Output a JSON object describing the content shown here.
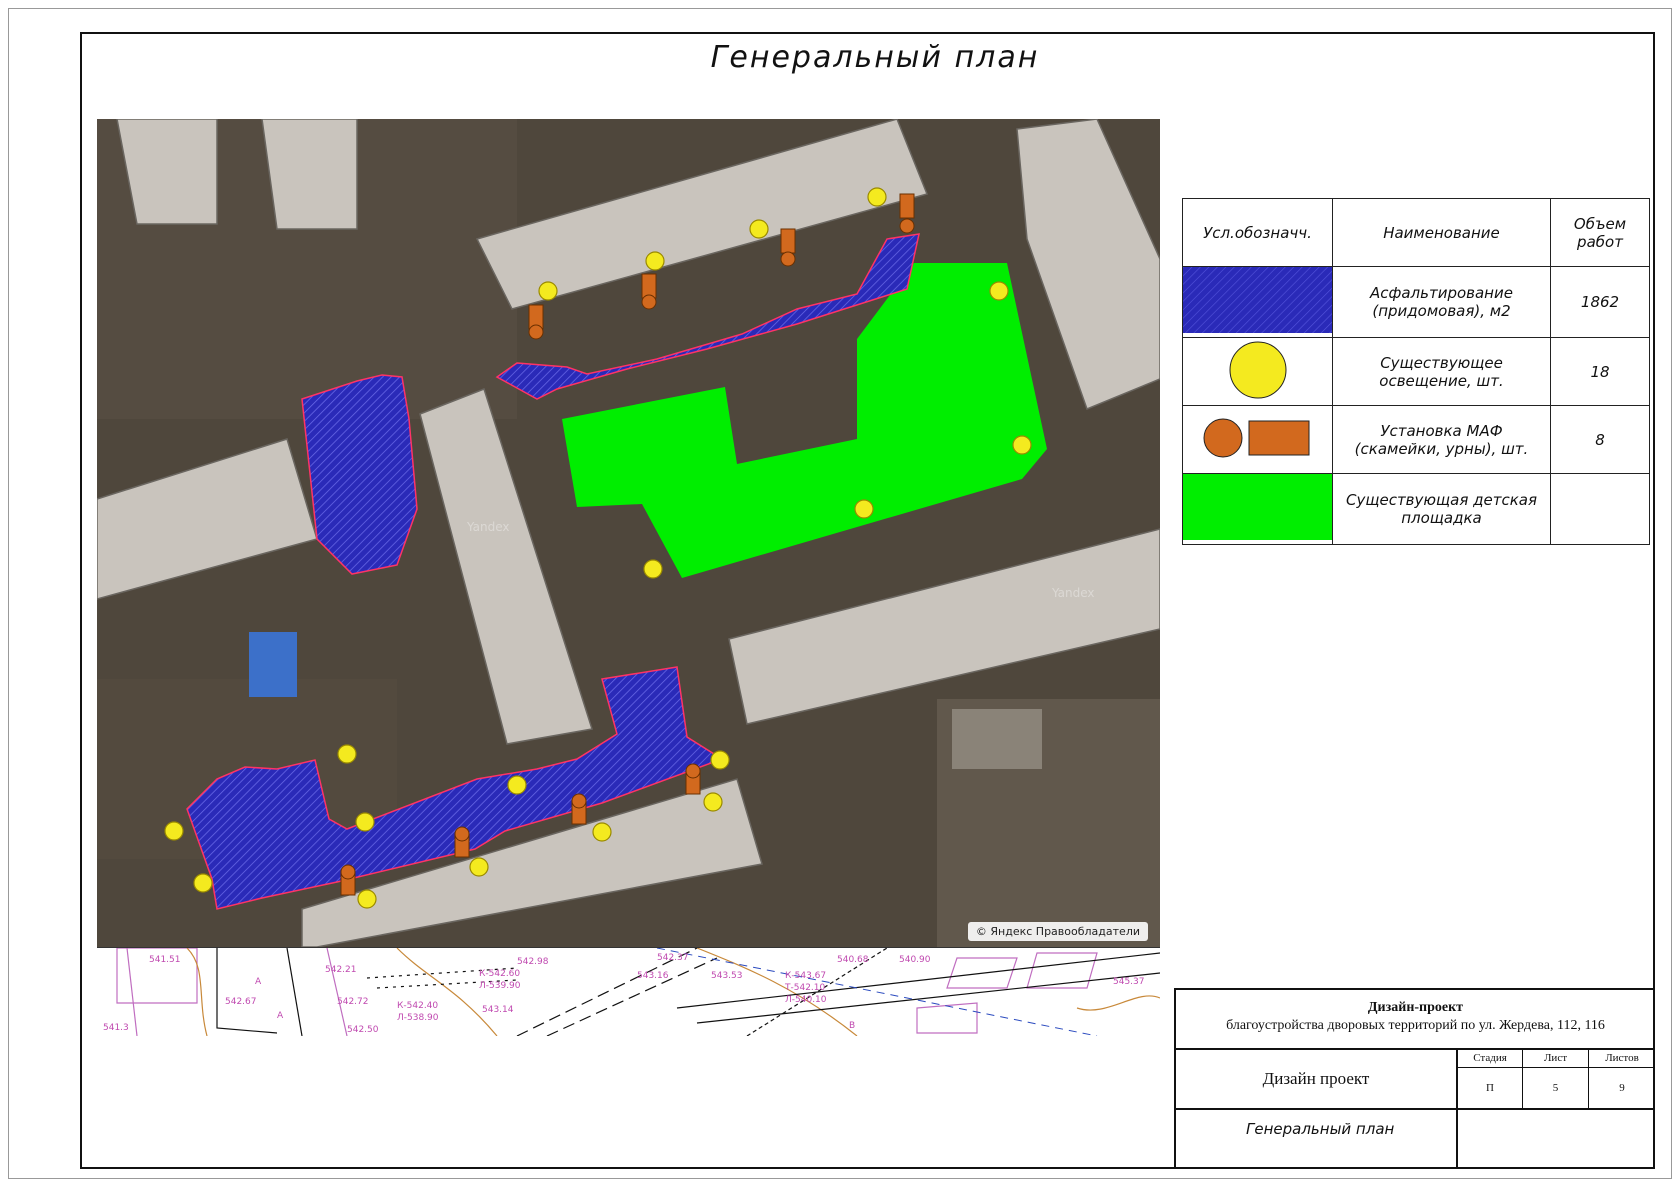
{
  "title": "Генеральный план",
  "map": {
    "copyright": "© Яндекс  Правообладатели",
    "watermarks": [
      "Yandex",
      "Yandex"
    ]
  },
  "plan_labels": [
    "541.51",
    "542.67",
    "541.3",
    "542.21",
    "542.72",
    "542.50",
    "542.98",
    "К-542.60",
    "Л-539.90",
    "К-542.40",
    "Л-538.90",
    "543.14",
    "543.16",
    "543.53",
    "542.37",
    "К-543.67",
    "Т-542.10",
    "Л-540.10",
    "540.68",
    "540.90",
    "545.37",
    "А",
    "А",
    "В"
  ],
  "legend": {
    "headers": [
      "Усл.обозначч.",
      "Наименование",
      "Объем работ"
    ],
    "rows": [
      {
        "symbol": "hatched-blue",
        "name": "Асфальтирование (придомовая), м2",
        "volume": "1862"
      },
      {
        "symbol": "yellow-circle",
        "name": "Существующее освещение, шт.",
        "volume": "18"
      },
      {
        "symbol": "orange-maf",
        "name": "Установка МАФ (скамейки, урны), шт.",
        "volume": "8"
      },
      {
        "symbol": "green-fill",
        "name": "Существующая детская площадка",
        "volume": ""
      }
    ],
    "colors": {
      "asphalt": "#2a2ab8",
      "light": "#f4ea1f",
      "maf": "#d2691e",
      "playground": "#00ee00"
    }
  },
  "stamp": {
    "project_title": "Дизайн-проект",
    "project_subtitle": "благоустройства дворовых территорий по ул. Жердева, 112, 116",
    "stage_label": "Стадия",
    "sheet_label": "Лист",
    "sheets_label": "Листов",
    "left_text": "Дизайн проект",
    "stage": "П",
    "sheet": "5",
    "sheets": "9",
    "sheet_title": "Генеральный план"
  }
}
